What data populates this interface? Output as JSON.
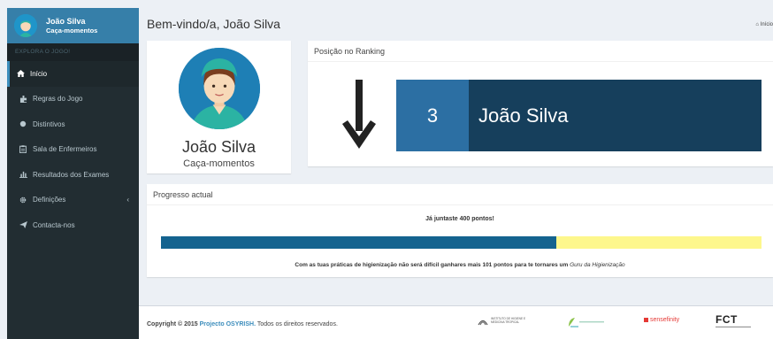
{
  "user": {
    "name": "João Silva",
    "role": "Caça-momentos"
  },
  "sidebar": {
    "header": "EXPLORA O JOGO!",
    "items": [
      {
        "label": "Início",
        "icon": "home-icon",
        "active": true
      },
      {
        "label": "Regras do Jogo",
        "icon": "puzzle-icon"
      },
      {
        "label": "Distintivos",
        "icon": "circle-icon"
      },
      {
        "label": "Sala de Enfermeiros",
        "icon": "clipboard-icon"
      },
      {
        "label": "Resultados dos Exames",
        "icon": "bar-chart-icon"
      },
      {
        "label": "Definições",
        "icon": "gear-icon",
        "has_submenu": true
      },
      {
        "label": "Contacta-nos",
        "icon": "send-icon"
      }
    ]
  },
  "header": {
    "title": "Bem-vindo/a, João Silva",
    "breadcrumb": "Início"
  },
  "profile": {
    "name": "João Silva",
    "role": "Caça-momentos"
  },
  "ranking": {
    "title": "Posição no Ranking",
    "position": "3",
    "name": "João Silva",
    "trend": "down"
  },
  "progress": {
    "title": "Progresso actual",
    "message": "Já juntaste 400 pontos!",
    "fraction": 0.659,
    "hint_prefix": "Com as tuas práticas de higienização não será difícil ganhares mais 101 pontos para te tornares um",
    "hint_level": "Guru da Higienização"
  },
  "footer": {
    "copyright_label": "Copyright © 2015",
    "project_link": "Projecto OSYRISH.",
    "rights": " Todos os direitos reservados.",
    "logos": {
      "ihmt_line1": "INSTITUTO DE HIGIENE E",
      "ihmt_line2": "MEDICINA TROPICAL",
      "sensefinity": "sensefinity",
      "fct": "FCT"
    }
  },
  "colors": {
    "sidebar_bg": "#222d32",
    "user_panel": "#367fa9",
    "rank_position": "#2c6fa3",
    "rank_name": "#163f5c",
    "progress_fill": "#14638f",
    "progress_track": "#fdf78c"
  }
}
